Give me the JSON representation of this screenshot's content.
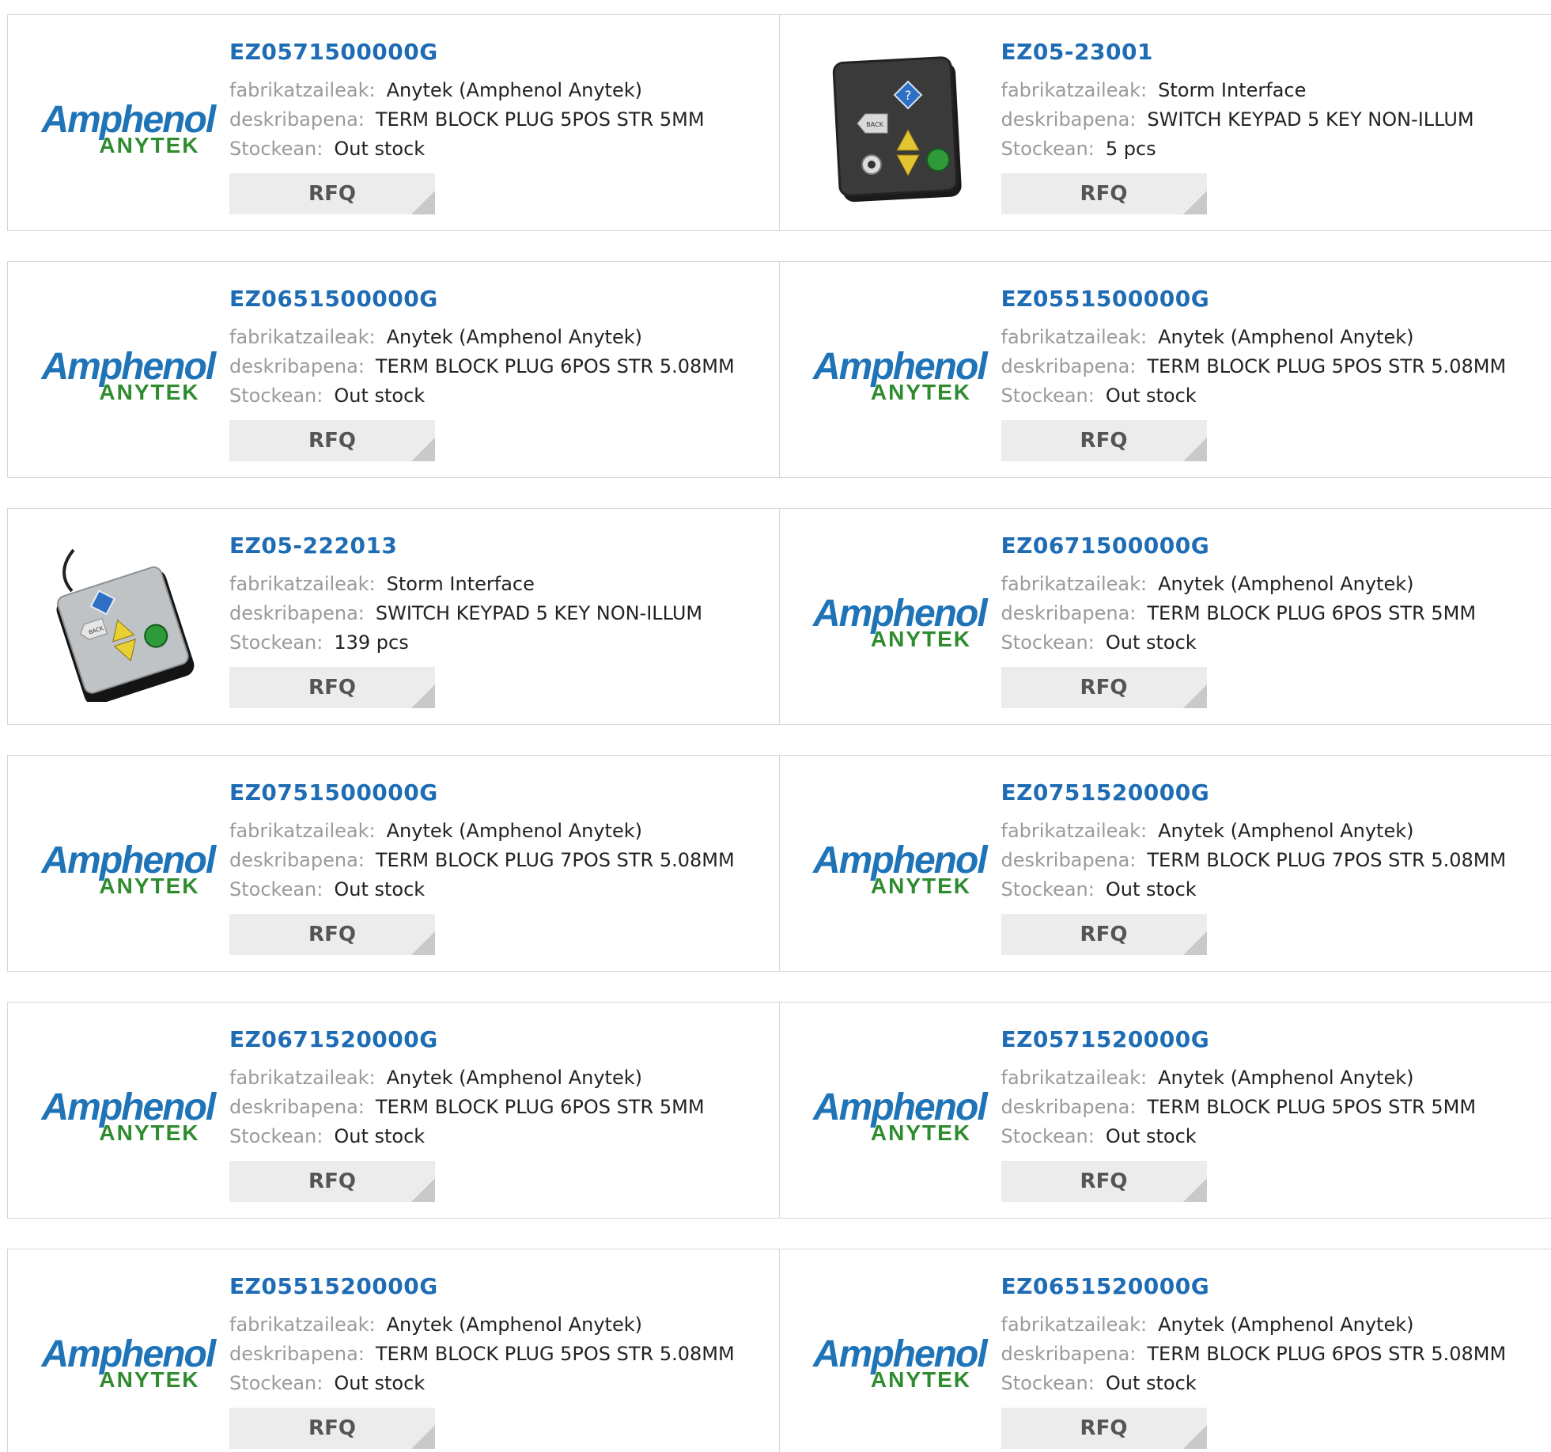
{
  "labels": {
    "manufacturer": "fabrikatzaileak:",
    "description": "deskribapena:",
    "stock": "Stockean:",
    "rfq": "RFQ"
  },
  "logo": {
    "brand": "Amphenol",
    "sub": "ANYTEK"
  },
  "keypad_text": {
    "back": "BACK",
    "help": "?"
  },
  "products": [
    {
      "pn": "EZ0571500000G",
      "manufacturer": "Anytek (Amphenol Anytek)",
      "description": "TERM BLOCK PLUG 5POS STR 5MM",
      "stock": "Out stock",
      "image": "amphenol-logo"
    },
    {
      "pn": "EZ05-23001",
      "manufacturer": "Storm Interface",
      "description": "SWITCH KEYPAD 5 KEY NON-ILLUM",
      "stock": "5 pcs",
      "image": "keypad-panel"
    },
    {
      "pn": "EZ0651500000G",
      "manufacturer": "Anytek (Amphenol Anytek)",
      "description": "TERM BLOCK PLUG 6POS STR 5.08MM",
      "stock": "Out stock",
      "image": "amphenol-logo"
    },
    {
      "pn": "EZ0551500000G",
      "manufacturer": "Anytek (Amphenol Anytek)",
      "description": "TERM BLOCK PLUG 5POS STR 5.08MM",
      "stock": "Out stock",
      "image": "amphenol-logo"
    },
    {
      "pn": "EZ05-222013",
      "manufacturer": "Storm Interface",
      "description": "SWITCH KEYPAD 5 KEY NON-ILLUM",
      "stock": "139 pcs",
      "image": "keypad-desktop"
    },
    {
      "pn": "EZ0671500000G",
      "manufacturer": "Anytek (Amphenol Anytek)",
      "description": "TERM BLOCK PLUG 6POS STR 5MM",
      "stock": "Out stock",
      "image": "amphenol-logo"
    },
    {
      "pn": "EZ0751500000G",
      "manufacturer": "Anytek (Amphenol Anytek)",
      "description": "TERM BLOCK PLUG 7POS STR 5.08MM",
      "stock": "Out stock",
      "image": "amphenol-logo"
    },
    {
      "pn": "EZ0751520000G",
      "manufacturer": "Anytek (Amphenol Anytek)",
      "description": "TERM BLOCK PLUG 7POS STR 5.08MM",
      "stock": "Out stock",
      "image": "amphenol-logo"
    },
    {
      "pn": "EZ0671520000G",
      "manufacturer": "Anytek (Amphenol Anytek)",
      "description": "TERM BLOCK PLUG 6POS STR 5MM",
      "stock": "Out stock",
      "image": "amphenol-logo"
    },
    {
      "pn": "EZ0571520000G",
      "manufacturer": "Anytek (Amphenol Anytek)",
      "description": "TERM BLOCK PLUG 5POS STR 5MM",
      "stock": "Out stock",
      "image": "amphenol-logo"
    },
    {
      "pn": "EZ0551520000G",
      "manufacturer": "Anytek (Amphenol Anytek)",
      "description": "TERM BLOCK PLUG 5POS STR 5.08MM",
      "stock": "Out stock",
      "image": "amphenol-logo"
    },
    {
      "pn": "EZ0651520000G",
      "manufacturer": "Anytek (Amphenol Anytek)",
      "description": "TERM BLOCK PLUG 6POS STR 5.08MM",
      "stock": "Out stock",
      "image": "amphenol-logo"
    }
  ]
}
